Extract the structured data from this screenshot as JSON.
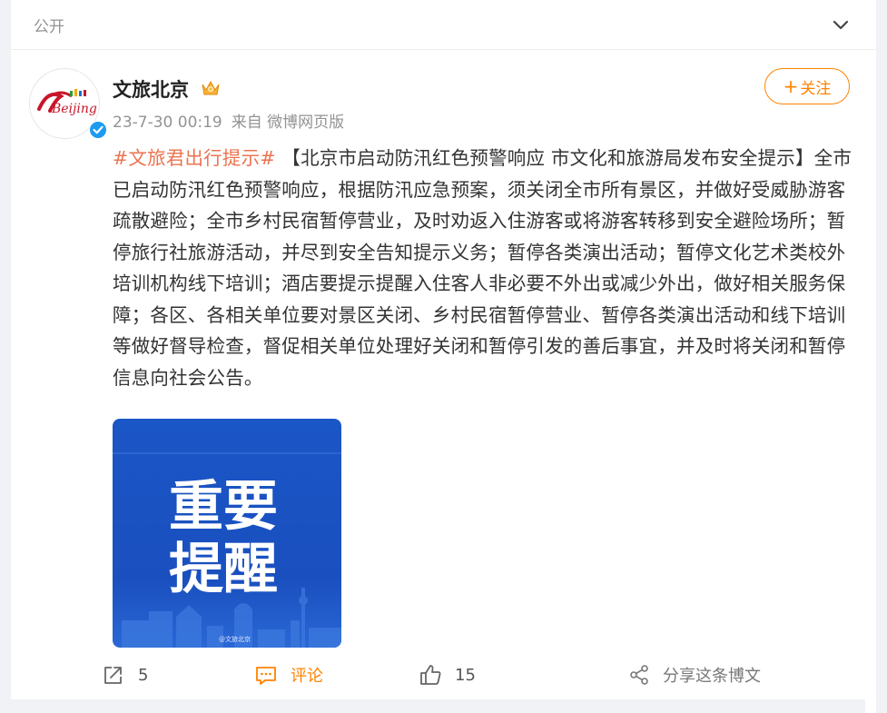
{
  "post": {
    "visibility": "公开",
    "author": {
      "name": "文旅北京",
      "avatar_text": "Beijing",
      "verified": true
    },
    "time": "23-7-30 00:19",
    "source": "来自 微博网页版",
    "follow_label": "关注",
    "hashtag": "#文旅君出行提示#",
    "content": " 【北京市启动防汛红色预警响应 市文化和旅游局发布安全提示】全市已启动防汛红色预警响应，根据防汛应急预案，须关闭全市所有景区，并做好受威胁游客疏散避险；全市乡村民宿暂停营业，及时劝返入住游客或将游客转移到安全避险场所；暂停旅行社旅游活动，并尽到安全告知提示义务；暂停各类演出活动；暂停文化艺术类校外培训机构线下培训；酒店要提示提醒入住客人非必要不外出或减少外出，做好相关服务保障；各区、各相关单位要对景区关闭、乡村民宿暂停营业、暂停各类演出活动和线下培训等做好督导检查，督促相关单位处理好关闭和暂停引发的善后事宜，并及时将关闭和暂停信息向社会公告。",
    "image": {
      "line1": "重要",
      "line2": "提醒",
      "watermark": "@文旅北京"
    },
    "actions": {
      "repost_count": "5",
      "comment_label": "评论",
      "like_count": "15",
      "share_label": "分享这条博文"
    }
  },
  "colors": {
    "accent": "#ff8200",
    "hashtag": "#eb7350",
    "image_blue": "#1a56c4"
  }
}
